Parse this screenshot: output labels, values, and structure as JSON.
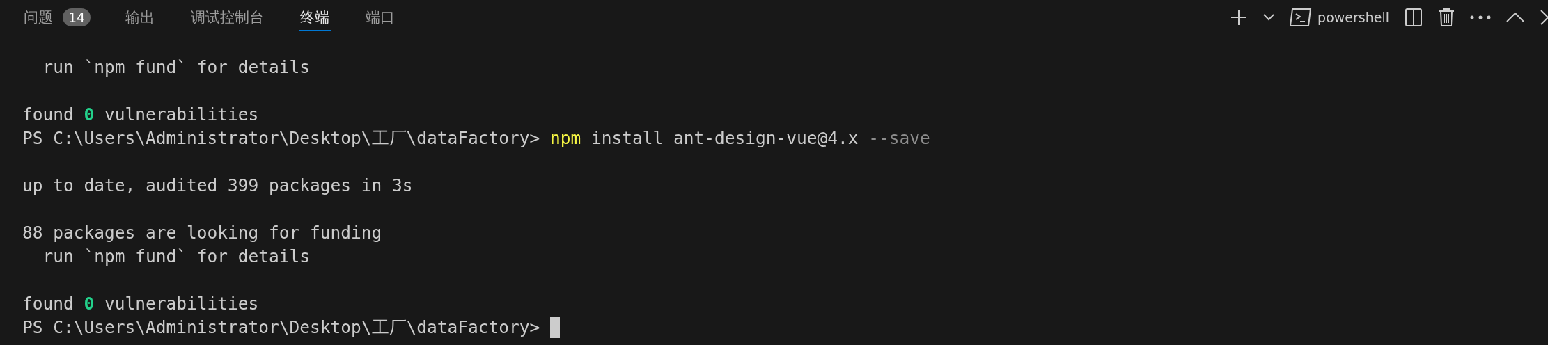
{
  "panel_tabs": [
    {
      "label": "问题",
      "badge": "14",
      "selected": false
    },
    {
      "label": "输出",
      "selected": false
    },
    {
      "label": "调试控制台",
      "selected": false
    },
    {
      "label": "终端",
      "selected": true
    },
    {
      "label": "端口",
      "selected": false
    }
  ],
  "toolbar": {
    "terminal_name": "powershell"
  },
  "terminal": {
    "cursor": true,
    "lines": [
      {
        "kind": "text",
        "segments": [
          {
            "kind": "plain",
            "text": "  run `npm fund` for details"
          }
        ]
      },
      {
        "kind": "blank"
      },
      {
        "kind": "text",
        "segments": [
          {
            "kind": "plain",
            "text": "found "
          },
          {
            "kind": "number",
            "text": "0"
          },
          {
            "kind": "plain",
            "text": " vulnerabilities"
          }
        ]
      },
      {
        "kind": "text",
        "segments": [
          {
            "kind": "plain",
            "text": "PS C:\\Users\\Administrator\\Desktop\\工厂\\dataFactory> "
          },
          {
            "kind": "command",
            "text": "npm"
          },
          {
            "kind": "plain",
            "text": " install ant-design-vue@4.x "
          },
          {
            "kind": "flag",
            "text": "--save"
          }
        ]
      },
      {
        "kind": "blank"
      },
      {
        "kind": "text",
        "segments": [
          {
            "kind": "plain",
            "text": "up to date, audited 399 packages in 3s"
          }
        ]
      },
      {
        "kind": "blank"
      },
      {
        "kind": "text",
        "segments": [
          {
            "kind": "plain",
            "text": "88 packages are looking for funding"
          }
        ]
      },
      {
        "kind": "text",
        "segments": [
          {
            "kind": "plain",
            "text": "  run `npm fund` for details"
          }
        ]
      },
      {
        "kind": "blank"
      },
      {
        "kind": "text",
        "segments": [
          {
            "kind": "plain",
            "text": "found "
          },
          {
            "kind": "number",
            "text": "0"
          },
          {
            "kind": "plain",
            "text": " vulnerabilities"
          }
        ]
      },
      {
        "kind": "text",
        "segments": [
          {
            "kind": "plain",
            "text": "PS C:\\Users\\Administrator\\Desktop\\工厂\\dataFactory> "
          }
        ]
      }
    ]
  }
}
